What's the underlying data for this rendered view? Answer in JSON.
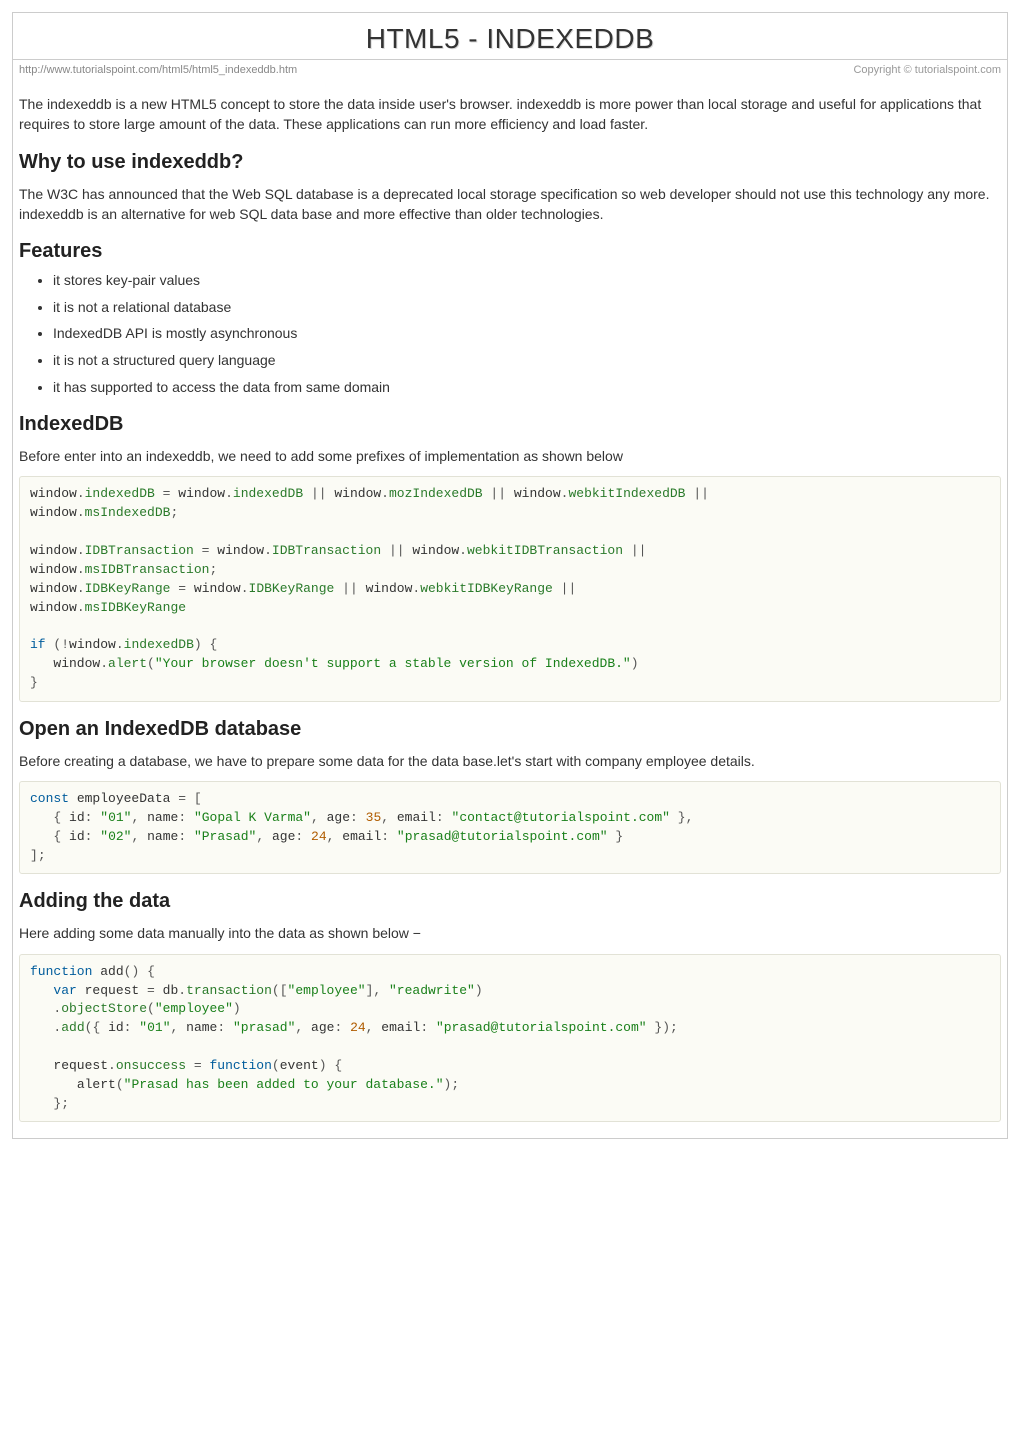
{
  "title": "HTML5 - INDEXEDDB",
  "meta": {
    "url": "http://www.tutorialspoint.com/html5/html5_indexeddb.htm",
    "copyright": "Copyright © tutorialspoint.com"
  },
  "intro": "The indexeddb is a new HTML5 concept to store the data inside user's browser. indexeddb is more power than local storage and useful for applications that requires to store large amount of the data. These applications can run more efficiency and load faster.",
  "sections": {
    "why": {
      "heading": "Why to use indexeddb?",
      "body": "The W3C has announced that the Web SQL database is a deprecated local storage specification so web developer should not use this technology any more. indexeddb is an alternative for web SQL data base and more effective than older technologies."
    },
    "features": {
      "heading": "Features",
      "items": [
        "it stores key-pair values",
        "it is not a relational database",
        "IndexedDB API is mostly asynchronous",
        "it is not a structured query language",
        "it has supported to access the data from same domain"
      ]
    },
    "indexeddb": {
      "heading": "IndexedDB",
      "body": "Before enter into an indexeddb, we need to add some prefixes of implementation as shown below",
      "code": "window.indexedDB = window.indexedDB || window.mozIndexedDB || window.webkitIndexedDB || \nwindow.msIndexedDB;\n \nwindow.IDBTransaction = window.IDBTransaction || window.webkitIDBTransaction || \nwindow.msIDBTransaction;\nwindow.IDBKeyRange = window.IDBKeyRange || window.webkitIDBKeyRange || \nwindow.msIDBKeyRange\n \nif (!window.indexedDB) {\n   window.alert(\"Your browser doesn't support a stable version of IndexedDB.\")\n}"
    },
    "open": {
      "heading": "Open an IndexedDB database",
      "body": "Before creating a database, we have to prepare some data for the data base.let's start with company employee details.",
      "code": "const employeeData = [\n   { id: \"01\", name: \"Gopal K Varma\", age: 35, email: \"contact@tutorialspoint.com\" },\n   { id: \"02\", name: \"Prasad\", age: 24, email: \"prasad@tutorialspoint.com\" }\n];"
    },
    "adding": {
      "heading": "Adding the data",
      "body": "Here adding some data manually into the data as shown below −",
      "code": "function add() {\n   var request = db.transaction([\"employee\"], \"readwrite\")\n   .objectStore(\"employee\")\n   .add({ id: \"01\", name: \"prasad\", age: 24, email: \"prasad@tutorialspoint.com\" });\n   \n   request.onsuccess = function(event) {\n      alert(\"Prasad has been added to your database.\");\n   };"
    }
  }
}
